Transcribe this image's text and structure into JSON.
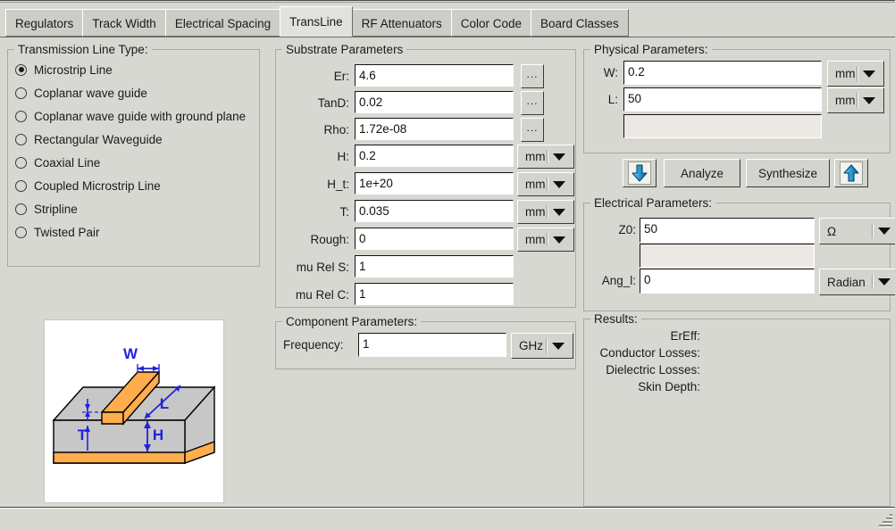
{
  "window": {
    "title": "TransLine"
  },
  "tabs": [
    {
      "label": "Regulators",
      "active": false
    },
    {
      "label": "Track Width",
      "active": false
    },
    {
      "label": "Electrical Spacing",
      "active": false
    },
    {
      "label": "TransLine",
      "active": true
    },
    {
      "label": "RF Attenuators",
      "active": false
    },
    {
      "label": "Color Code",
      "active": false
    },
    {
      "label": "Board Classes",
      "active": false
    }
  ],
  "line_type": {
    "legend": "Transmission Line Type:",
    "selected": "Microstrip Line",
    "options": [
      "Microstrip Line",
      "Coplanar wave guide",
      "Coplanar wave guide with ground plane",
      "Rectangular Waveguide",
      "Coaxial Line",
      "Coupled Microstrip Line",
      "Stripline",
      "Twisted Pair"
    ]
  },
  "diagram": {
    "name": "microstrip-line-diagram",
    "labels": {
      "w": "W",
      "l": "L",
      "t": "T",
      "h": "H"
    },
    "colors": {
      "copper": "#FFAD4D",
      "substrate": "#C7C7C7",
      "dimension": "#2222DD"
    }
  },
  "substrate": {
    "legend": "Substrate Parameters",
    "rows": [
      {
        "label": "Er:",
        "value": "4.6",
        "button": "...",
        "unit": null
      },
      {
        "label": "TanD:",
        "value": "0.02",
        "button": "...",
        "unit": null
      },
      {
        "label": "Rho:",
        "value": "1.72e-08",
        "button": "...",
        "unit": null
      },
      {
        "label": "H:",
        "value": "0.2",
        "button": null,
        "unit": "mm"
      },
      {
        "label": "H_t:",
        "value": "1e+20",
        "button": null,
        "unit": "mm"
      },
      {
        "label": "T:",
        "value": "0.035",
        "button": null,
        "unit": "mm"
      },
      {
        "label": "Rough:",
        "value": "0",
        "button": null,
        "unit": "mm"
      },
      {
        "label": "mu Rel S:",
        "value": "1",
        "button": null,
        "unit": null
      },
      {
        "label": "mu Rel C:",
        "value": "1",
        "button": null,
        "unit": null
      }
    ]
  },
  "component": {
    "legend": "Component Parameters:",
    "frequency_label": "Frequency:",
    "frequency_value": "1",
    "frequency_unit": "GHz"
  },
  "physical": {
    "legend": "Physical Parameters:",
    "rows": [
      {
        "label": "W:",
        "value": "0.2",
        "unit": "mm"
      },
      {
        "label": "L:",
        "value": "50",
        "unit": "mm"
      }
    ],
    "extra_value": ""
  },
  "actions": {
    "analyze_label": "Analyze",
    "synthesize_label": "Synthesize",
    "down_arrow_name": "arrow-down-icon",
    "up_arrow_name": "arrow-up-icon"
  },
  "electrical": {
    "legend": "Electrical Parameters:",
    "z0_label": "Z0:",
    "z0_value": "50",
    "z0_unit": "Ω",
    "mid_value": "",
    "ang_label": "Ang_l:",
    "ang_value": "0",
    "ang_unit": "Radian"
  },
  "results": {
    "legend": "Results:",
    "rows": [
      {
        "label": "ErEff:",
        "value": ""
      },
      {
        "label": "Conductor Losses:",
        "value": ""
      },
      {
        "label": "Dielectric Losses:",
        "value": ""
      },
      {
        "label": "Skin Depth:",
        "value": ""
      }
    ]
  }
}
